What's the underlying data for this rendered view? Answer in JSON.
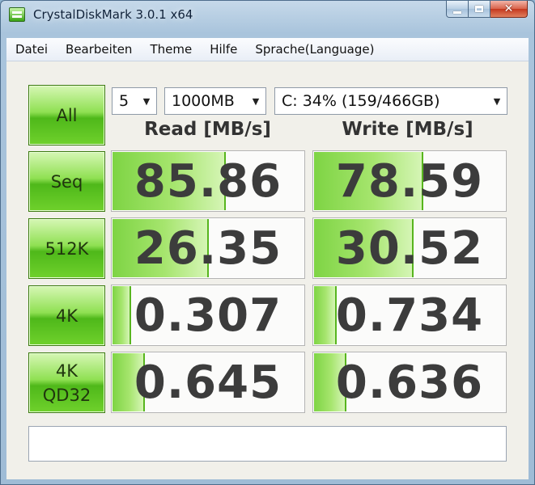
{
  "window": {
    "title": "CrystalDiskMark 3.0.1 x64",
    "icon": "crystaldiskmark-app-icon"
  },
  "caption_buttons": {
    "minimize": "minimize-icon",
    "maximize": "maximize-icon",
    "close": "close-icon",
    "close_glyph": "✕"
  },
  "menu": [
    "Datei",
    "Bearbeiten",
    "Theme",
    "Hilfe",
    "Sprache(Language)"
  ],
  "controls": {
    "all_label": "All",
    "count": "5",
    "size": "1000MB",
    "drive": "C: 34% (159/466GB)",
    "dropdown_arrow": "▼"
  },
  "headers": {
    "read": "Read [MB/s]",
    "write": "Write [MB/s]"
  },
  "tests": [
    {
      "label": "Seq",
      "read": "85.86",
      "write": "78.59",
      "read_fill": 0.58,
      "write_fill": 0.56
    },
    {
      "label": "512K",
      "read": "26.35",
      "write": "30.52",
      "read_fill": 0.49,
      "write_fill": 0.51
    },
    {
      "label": "4K",
      "read": "0.307",
      "write": "0.734",
      "read_fill": 0.09,
      "write_fill": 0.11
    },
    {
      "label": "4K\nQD32",
      "read": "0.645",
      "write": "0.636",
      "read_fill": 0.16,
      "write_fill": 0.16
    }
  ],
  "comment": "",
  "colors": {
    "bar_green": "#7ed444",
    "button_green": "#6fd12c",
    "value_text": "#3c3c3c"
  }
}
